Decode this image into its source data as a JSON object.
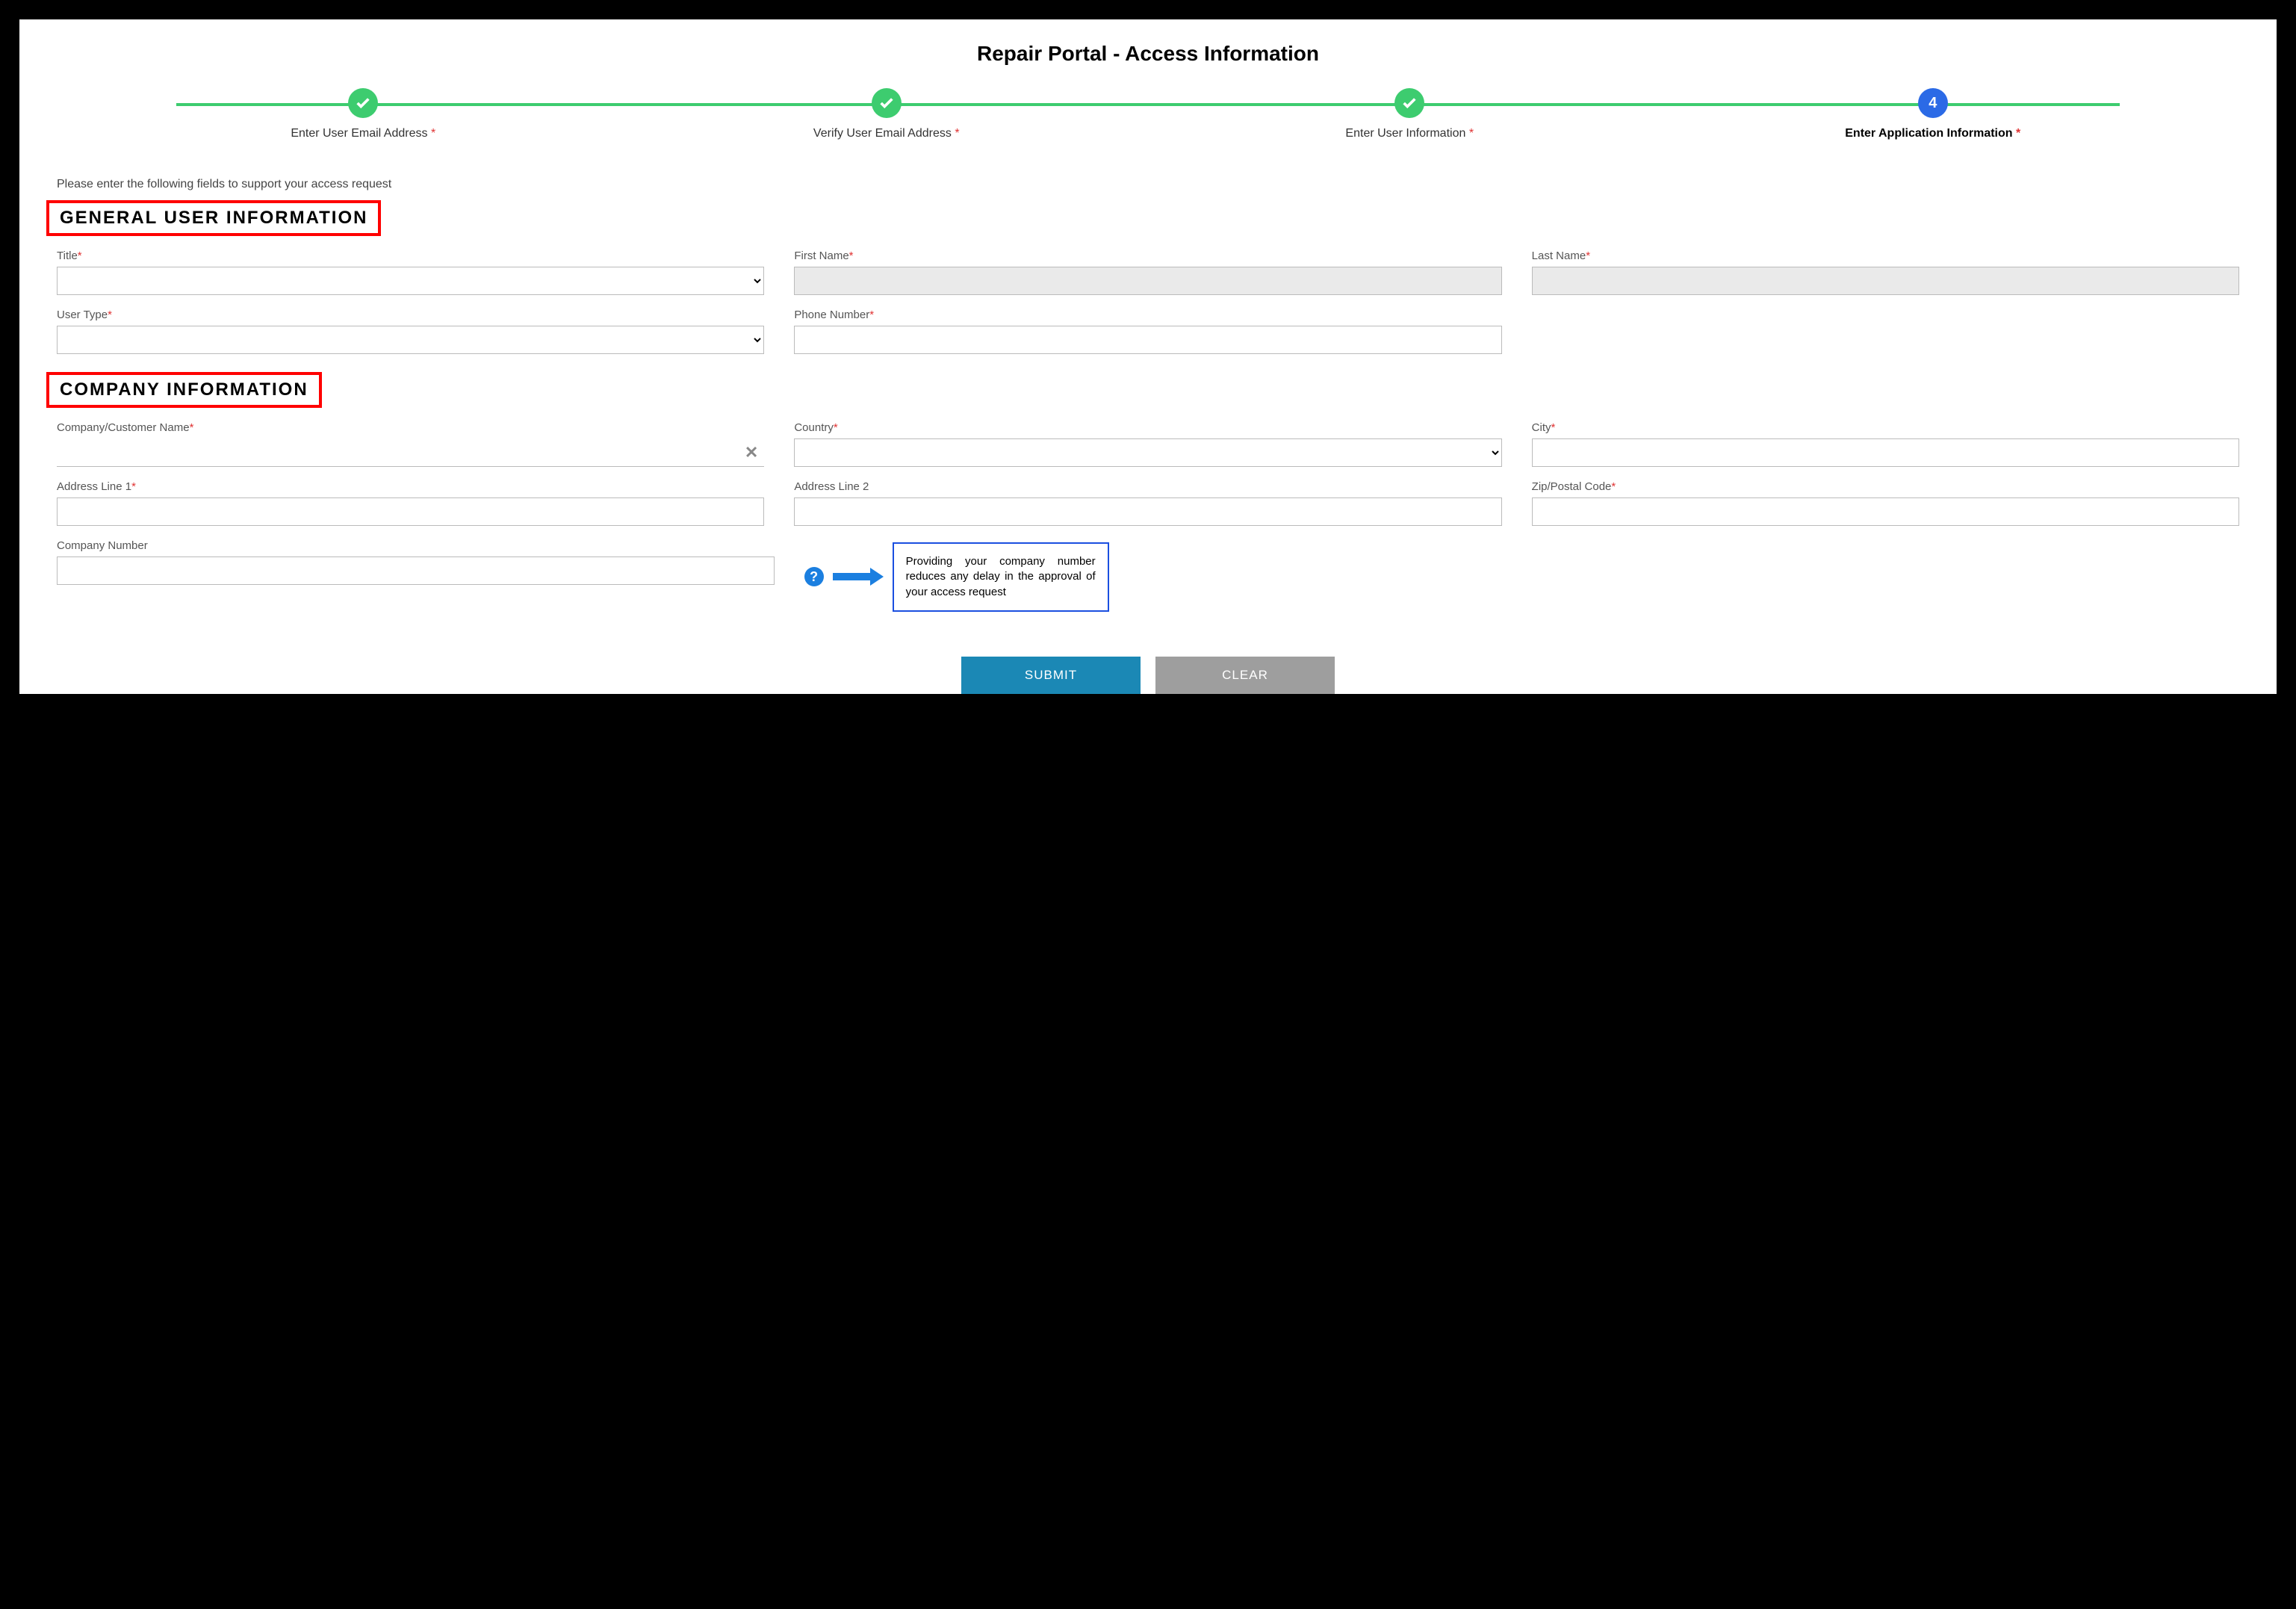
{
  "page": {
    "title": "Repair Portal - Access Information",
    "instruction": "Please enter the following fields to support your access request"
  },
  "stepper": {
    "steps": [
      {
        "label": "Enter User Email Address",
        "required": true,
        "state": "completed"
      },
      {
        "label": "Verify User Email Address",
        "required": true,
        "state": "completed"
      },
      {
        "label": "Enter User Information",
        "required": true,
        "state": "completed"
      },
      {
        "label": "Enter Application Information",
        "required": true,
        "state": "active",
        "number": "4"
      }
    ]
  },
  "sections": {
    "general": {
      "heading": "GENERAL USER INFORMATION",
      "fields": {
        "title": {
          "label": "Title",
          "required": true,
          "value": ""
        },
        "firstName": {
          "label": "First Name",
          "required": true,
          "value": ""
        },
        "lastName": {
          "label": "Last Name",
          "required": true,
          "value": ""
        },
        "userType": {
          "label": "User Type",
          "required": true,
          "value": ""
        },
        "phone": {
          "label": "Phone Number",
          "required": true,
          "value": ""
        }
      }
    },
    "company": {
      "heading": "COMPANY INFORMATION",
      "fields": {
        "companyName": {
          "label": "Company/Customer Name",
          "required": true,
          "value": ""
        },
        "country": {
          "label": "Country",
          "required": true,
          "value": ""
        },
        "city": {
          "label": "City",
          "required": true,
          "value": ""
        },
        "address1": {
          "label": "Address Line 1",
          "required": true,
          "value": ""
        },
        "address2": {
          "label": "Address Line 2",
          "required": false,
          "value": ""
        },
        "zip": {
          "label": "Zip/Postal Code",
          "required": true,
          "value": ""
        },
        "companyNumber": {
          "label": "Company Number",
          "required": false,
          "value": ""
        }
      }
    }
  },
  "callout": {
    "text": "Providing your company number reduces any delay in the approval of your access request"
  },
  "buttons": {
    "submit": "SUBMIT",
    "clear": "CLEAR"
  },
  "requiredMark": "*"
}
